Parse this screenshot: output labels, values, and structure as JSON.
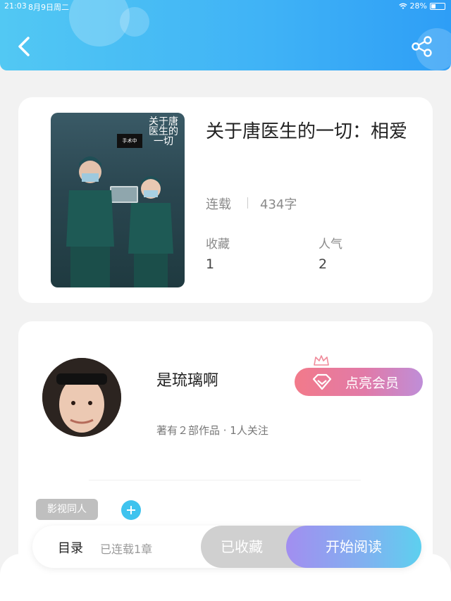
{
  "status_bar": {
    "time": "21:03",
    "date": "8月9日周二",
    "battery": "28%",
    "icons": [
      "wifi-icon",
      "battery-icon"
    ]
  },
  "header": {
    "back_icon": "chevron-left-icon",
    "share_icon": "share-icon",
    "accent": "#3fb2f6"
  },
  "book": {
    "title": "关于唐医生的一切：相爱",
    "status": "连载",
    "word_count": "434字",
    "stats": [
      {
        "label": "收藏",
        "value": "1"
      },
      {
        "label": "人气",
        "value": "2"
      }
    ],
    "cover": {
      "title_text": "关于唐医生的一切",
      "sign_text": "手术中"
    }
  },
  "author": {
    "name": "是琉璃啊",
    "meta": "著有２部作品 · 1人关注",
    "vip_label": "点亮会员",
    "vip_icon": "diamond-icon",
    "crown_icon": "crown-icon"
  },
  "tags": {
    "items": [
      "影视同人"
    ],
    "add_icon": "plus-icon"
  },
  "bottom_bar": {
    "toc_label": "目录",
    "toc_info": "已连载1章",
    "collected_label": "已收藏",
    "read_label": "开始阅读"
  }
}
